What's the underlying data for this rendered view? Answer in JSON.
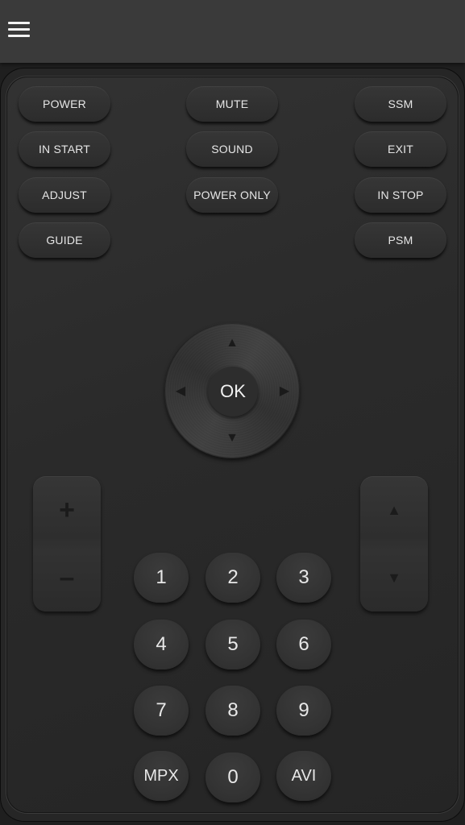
{
  "topbar": {
    "menu_icon": "hamburger-menu-icon"
  },
  "function_buttons": {
    "power": "POWER",
    "mute": "MUTE",
    "ssm": "SSM",
    "in_start": "IN START",
    "sound": "SOUND",
    "exit": "EXIT",
    "adjust": "ADJUST",
    "power_only": "POWER ONLY",
    "in_stop": "IN STOP",
    "guide": "GUIDE",
    "psm": "PSM"
  },
  "dpad": {
    "ok_label": "OK",
    "up_glyph": "▲",
    "down_glyph": "▼",
    "left_glyph": "◀",
    "right_glyph": "▶"
  },
  "volume": {
    "plus_glyph": "+",
    "minus_glyph": "–"
  },
  "channel": {
    "up_glyph": "▲",
    "down_glyph": "▼"
  },
  "keypad": {
    "k1": "1",
    "k2": "2",
    "k3": "3",
    "k4": "4",
    "k5": "5",
    "k6": "6",
    "k7": "7",
    "k8": "8",
    "k9": "9",
    "mpx": "MPX",
    "k0": "0",
    "avi": "AVI"
  }
}
